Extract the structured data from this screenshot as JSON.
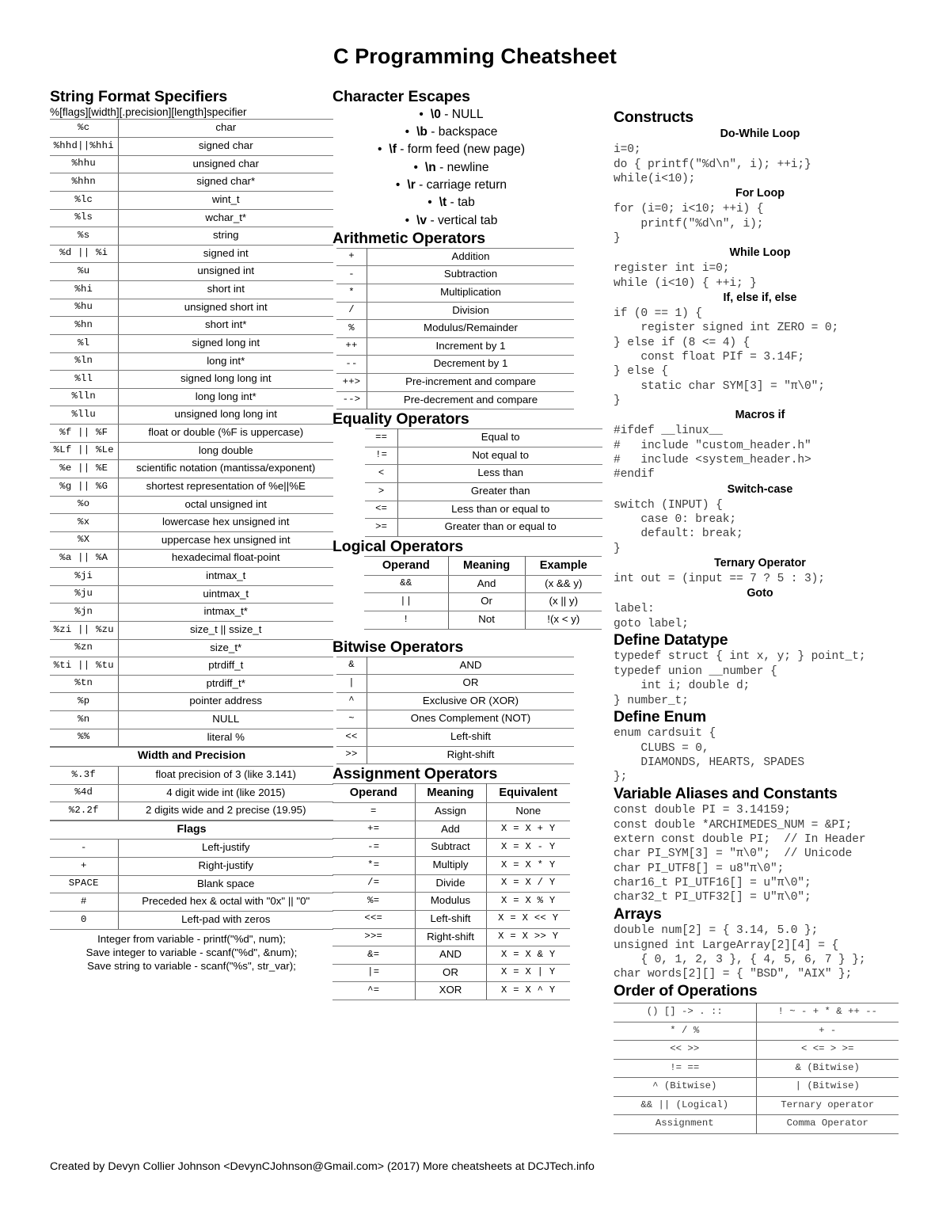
{
  "title": "C Programming Cheatsheet",
  "credit": "Created by Devyn Collier Johnson <DevynCJohnson@Gmail.com> (2017) More cheatsheets at DCJTech.info",
  "string_format": {
    "heading": "String Format Specifiers",
    "syntax": "%[flags][width][.precision][length]specifier",
    "rows": [
      [
        "%c",
        "char"
      ],
      [
        "%hhd||%hhi",
        "signed char"
      ],
      [
        "%hhu",
        "unsigned char"
      ],
      [
        "%hhn",
        "signed char*"
      ],
      [
        "%lc",
        "wint_t"
      ],
      [
        "%ls",
        "wchar_t*"
      ],
      [
        "%s",
        "string"
      ],
      [
        "%d || %i",
        "signed int"
      ],
      [
        "%u",
        "unsigned int"
      ],
      [
        "%hi",
        "short int"
      ],
      [
        "%hu",
        "unsigned short int"
      ],
      [
        "%hn",
        "short int*"
      ],
      [
        "%l",
        "signed long int"
      ],
      [
        "%ln",
        "long int*"
      ],
      [
        "%ll",
        "signed long long int"
      ],
      [
        "%lln",
        "long long int*"
      ],
      [
        "%llu",
        "unsigned long long int"
      ],
      [
        "%f || %F",
        "float or double (%F is uppercase)"
      ],
      [
        "%Lf || %Le",
        "long double"
      ],
      [
        "%e || %E",
        "scientific notation (mantissa/exponent)"
      ],
      [
        "%g || %G",
        "shortest representation of %e||%E"
      ],
      [
        "%o",
        "octal unsigned int"
      ],
      [
        "%x",
        "lowercase hex unsigned int"
      ],
      [
        "%X",
        "uppercase hex unsigned int"
      ],
      [
        "%a || %A",
        "hexadecimal float-point"
      ],
      [
        "%ji",
        "intmax_t"
      ],
      [
        "%ju",
        "uintmax_t"
      ],
      [
        "%jn",
        "intmax_t*"
      ],
      [
        "%zi || %zu",
        "size_t || ssize_t"
      ],
      [
        "%zn",
        "size_t*"
      ],
      [
        "%ti || %tu",
        "ptrdiff_t"
      ],
      [
        "%tn",
        "ptrdiff_t*"
      ],
      [
        "%p",
        "pointer address"
      ],
      [
        "%n",
        "NULL"
      ],
      [
        "%%",
        "literal %"
      ]
    ],
    "width_precision_heading": "Width and Precision",
    "width_precision_rows": [
      [
        "%.3f",
        "float precision of 3 (like 3.141)"
      ],
      [
        "%4d",
        "4 digit wide int (like 2015)"
      ],
      [
        "%2.2f",
        "2 digits wide and 2 precise (19.95)"
      ]
    ],
    "flags_heading": "Flags",
    "flags_rows": [
      [
        "-",
        "Left-justify"
      ],
      [
        "+",
        "Right-justify"
      ],
      [
        "SPACE",
        "Blank space"
      ],
      [
        "#",
        "Preceded hex & octal with \"0x\" || \"0\""
      ],
      [
        "0",
        "Left-pad with zeros"
      ]
    ],
    "footnotes": [
      "Integer from variable - printf(\"%d\", num);",
      "Save integer to variable - scanf(\"%d\", &num);",
      "Save string to variable - scanf(\"%s\", str_var);"
    ]
  },
  "character_escapes": {
    "heading": "Character Escapes",
    "items": [
      {
        "esc": "\\0",
        "desc": " - NULL"
      },
      {
        "esc": "\\b",
        "desc": " - backspace"
      },
      {
        "esc": "\\f",
        "desc": " - form feed (new page)"
      },
      {
        "esc": "\\n",
        "desc": " - newline"
      },
      {
        "esc": "\\r",
        "desc": " - carriage return"
      },
      {
        "esc": "\\t",
        "desc": " - tab"
      },
      {
        "esc": "\\v",
        "desc": " - vertical tab"
      }
    ]
  },
  "arithmetic": {
    "heading": "Arithmetic Operators",
    "rows": [
      [
        "+",
        "Addition"
      ],
      [
        "-",
        "Subtraction"
      ],
      [
        "*",
        "Multiplication"
      ],
      [
        "/",
        "Division"
      ],
      [
        "%",
        "Modulus/Remainder"
      ],
      [
        "++",
        "Increment by 1"
      ],
      [
        "--",
        "Decrement by 1"
      ],
      [
        "++>",
        "Pre-increment and compare"
      ],
      [
        "-->",
        "Pre-decrement and compare"
      ]
    ]
  },
  "equality": {
    "heading": "Equality Operators",
    "rows": [
      [
        "==",
        "Equal to"
      ],
      [
        "!=",
        "Not equal to"
      ],
      [
        "<",
        "Less than"
      ],
      [
        ">",
        "Greater than"
      ],
      [
        "<=",
        "Less than or equal to"
      ],
      [
        ">=",
        "Greater than or equal to"
      ]
    ]
  },
  "logical": {
    "heading": "Logical Operators",
    "headers": [
      "Operand",
      "Meaning",
      "Example"
    ],
    "rows": [
      [
        "&&",
        "And",
        "(x && y)"
      ],
      [
        "||",
        "Or",
        "(x || y)"
      ],
      [
        "!",
        "Not",
        "!(x < y)"
      ]
    ]
  },
  "bitwise": {
    "heading": "Bitwise Operators",
    "rows": [
      [
        "&",
        "AND"
      ],
      [
        "|",
        "OR"
      ],
      [
        "^",
        "Exclusive OR (XOR)"
      ],
      [
        "~",
        "Ones Complement (NOT)"
      ],
      [
        "<<",
        "Left-shift"
      ],
      [
        ">>",
        "Right-shift"
      ]
    ]
  },
  "assignment": {
    "heading": "Assignment Operators",
    "headers": [
      "Operand",
      "Meaning",
      "Equivalent"
    ],
    "rows": [
      [
        "=",
        "Assign",
        "None"
      ],
      [
        "+=",
        "Add",
        "X = X + Y"
      ],
      [
        "-=",
        "Subtract",
        "X = X - Y"
      ],
      [
        "*=",
        "Multiply",
        "X = X * Y"
      ],
      [
        "/=",
        "Divide",
        "X = X / Y"
      ],
      [
        "%=",
        "Modulus",
        "X = X % Y"
      ],
      [
        "<<=",
        "Left-shift",
        "X = X << Y"
      ],
      [
        ">>=",
        "Right-shift",
        "X = X >> Y"
      ],
      [
        "&=",
        "AND",
        "X = X & Y"
      ],
      [
        "|=",
        "OR",
        "X = X | Y"
      ],
      [
        "^=",
        "XOR",
        "X = X ^ Y"
      ]
    ]
  },
  "constructs": {
    "heading": "Constructs",
    "blocks": [
      {
        "label": "Do-While Loop",
        "code": "i=0;\ndo { printf(\"%d\\n\", i); ++i;}\nwhile(i<10);"
      },
      {
        "label": "For Loop",
        "code": "for (i=0; i<10; ++i) {\n    printf(\"%d\\n\", i);\n}"
      },
      {
        "label": "While Loop",
        "code": "register int i=0;\nwhile (i<10) { ++i; }"
      },
      {
        "label": "If, else if, else",
        "code": "if (0 == 1) {\n    register signed int ZERO = 0;\n} else if (8 <= 4) {\n    const float PIf = 3.14F;\n} else {\n    static char SYM[3] = \"π\\0\";\n}"
      },
      {
        "label": "Macros if",
        "code": "#ifdef __linux__\n#   include \"custom_header.h\"\n#   include <system_header.h>\n#endif"
      },
      {
        "label": "Switch-case",
        "code": "switch (INPUT) {\n    case 0: break;\n    default: break;\n}"
      },
      {
        "label": "Ternary Operator",
        "code": "int out = (input == 7 ? 5 : 3);"
      },
      {
        "label": "Goto",
        "code": "label:\ngoto label;"
      }
    ]
  },
  "define_datatype": {
    "heading": "Define Datatype",
    "code": "typedef struct { int x, y; } point_t;\ntypedef union __number {\n    int i; double d;\n} number_t;"
  },
  "define_enum": {
    "heading": "Define Enum",
    "code": "enum cardsuit {\n    CLUBS = 0,\n    DIAMONDS, HEARTS, SPADES\n};"
  },
  "variable_aliases": {
    "heading": "Variable Aliases and Constants",
    "code": "const double PI = 3.14159;\nconst double *ARCHIMEDES_NUM = &PI;\nextern const double PI;  // In Header\nchar PI_SYM[3] = \"π\\0\";  // Unicode\nchar PI_UTF8[] = u8\"π\\0\";\nchar16_t PI_UTF16[] = u\"π\\0\";\nchar32_t PI_UTF32[] = U\"π\\0\";"
  },
  "arrays": {
    "heading": "Arrays",
    "code": "double num[2] = { 3.14, 5.0 };\nunsigned int LargeArray[2][4] = {\n    { 0, 1, 2, 3 }, { 4, 5, 6, 7 } };\nchar words[2][] = { \"BSD\", \"AIX\" };"
  },
  "order_of_operations": {
    "heading": "Order of Operations",
    "rows": [
      [
        "() [] -> . ::",
        "! ~ - + * & ++ --"
      ],
      [
        "* / %",
        "+ -"
      ],
      [
        "<< >>",
        "< <= > >="
      ],
      [
        "!= ==",
        "& (Bitwise)"
      ],
      [
        "^ (Bitwise)",
        "| (Bitwise)"
      ],
      [
        "&& || (Logical)",
        "Ternary operator"
      ],
      [
        "Assignment",
        "Comma Operator"
      ]
    ]
  }
}
